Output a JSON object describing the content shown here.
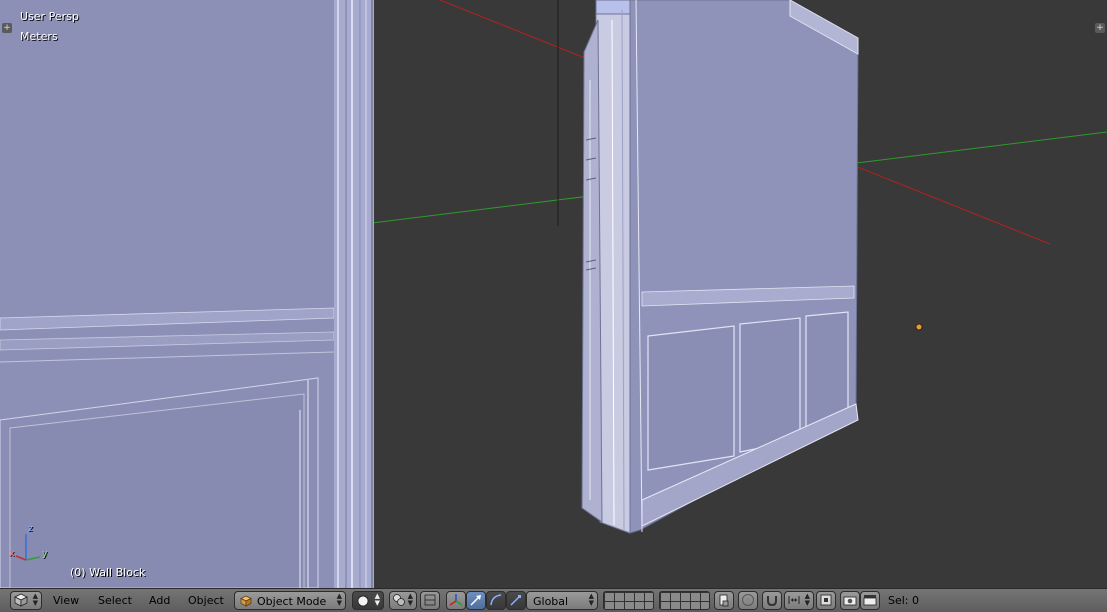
{
  "viewport": {
    "view_name": "User Persp",
    "units": "Meters",
    "object_label": "(0) Wall Block",
    "axes": {
      "x": "x",
      "y": "y",
      "z": "z"
    }
  },
  "header": {
    "editor_type_icon": "3d-view-cube-icon",
    "menus": {
      "view": "View",
      "select": "Select",
      "add": "Add",
      "object": "Object"
    },
    "mode": {
      "label": "Object Mode",
      "icon": "object-mode-cube-icon"
    },
    "shading_icon": "solid-shading-sphere-icon",
    "pivot_icon": "pivot-point-icon",
    "manipulator_icons": [
      "manipulator-toggle-icon",
      "translate-arrow-icon",
      "rotate-arc-icon",
      "scale-icon"
    ],
    "orientation": "Global",
    "layers": "layer-grid",
    "sel_label": "Sel: 0"
  },
  "colors": {
    "viewport_bg": "#393939",
    "mesh": "#8a8fb8",
    "x_axis": "#b02020",
    "y_axis": "#2f9a2f",
    "header": "#727272"
  }
}
